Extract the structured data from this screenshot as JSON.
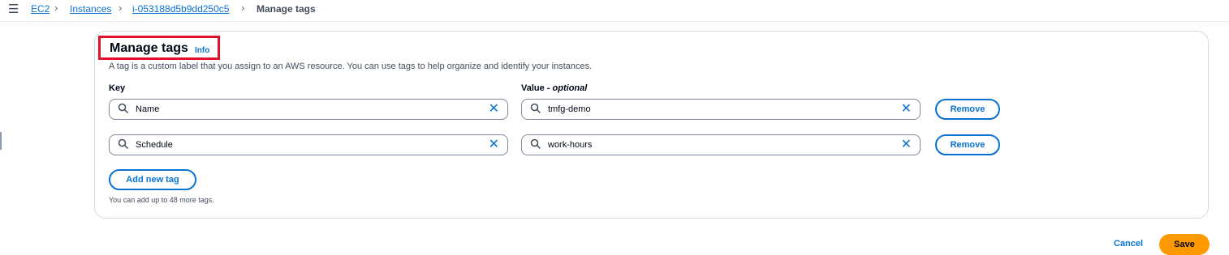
{
  "breadcrumb": {
    "items": [
      "EC2",
      "Instances",
      "i-053188d5b9dd250c5",
      "Manage tags"
    ]
  },
  "panel": {
    "title": "Manage tags",
    "info_link": "Info",
    "description": "A tag is a custom label that you assign to an AWS resource. You can use tags to help organize and identify your instances.",
    "key_label": "Key",
    "value_label": "Value - ",
    "value_label_optional": "optional",
    "tags": [
      {
        "key": "Name",
        "value": "tmfg-demo",
        "remove_label": "Remove"
      },
      {
        "key": "Schedule",
        "value": "work-hours",
        "remove_label": "Remove"
      }
    ],
    "add_tag_label": "Add new tag",
    "limit_hint": "You can add up to 48 more tags."
  },
  "footer": {
    "cancel_label": "Cancel",
    "save_label": "Save"
  },
  "colors": {
    "link": "#0972d3",
    "primary_button": "#ff9900",
    "highlight": "#e0112b"
  },
  "icons": [
    "menu-icon",
    "chevron-right-icon",
    "search-icon",
    "close-icon"
  ]
}
